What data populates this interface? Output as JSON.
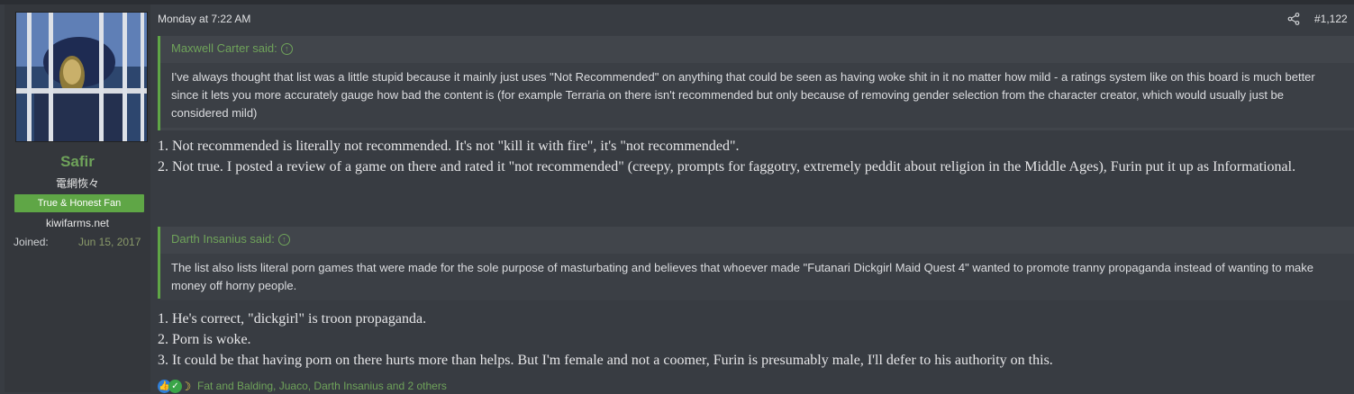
{
  "user": {
    "name": "Safir",
    "title": "電網恢々",
    "banner": "True & Honest Fan",
    "site": "kiwifarms.net",
    "joined_label": "Joined:",
    "joined_value": "Jun 15, 2017"
  },
  "post": {
    "date": "Monday at 7:22 AM",
    "number": "#1,122",
    "quote1": {
      "author": "Maxwell Carter said:",
      "text": "I've always thought that list was a little stupid because it mainly just uses \"Not Recommended\" on anything that could be seen as having woke shit in it no matter how mild - a ratings system like on this board is much better since it lets you more accurately gauge how bad the content is (for example Terraria on there isn't recommended but only because of removing gender selection from the character creator, which would usually just be considered mild)"
    },
    "reply1": [
      "1. Not recommended is literally not recommended. It's not \"kill it with fire\", it's \"not recommended\".",
      "2. Not true. I posted a review of a game on there and rated it \"not recommended\" (creepy, prompts for faggotry, extremely peddit about religion in the Middle Ages), Furin put it up as Informational."
    ],
    "quote2": {
      "author": "Darth Insanius said:",
      "text": "The list also lists literal porn games that were made for the sole purpose of masturbating and believes that whoever made \"Futanari Dickgirl Maid Quest 4\" wanted to promote tranny propaganda instead of wanting to make money off horny people."
    },
    "reply2": [
      "1. He's correct, \"dickgirl\" is troon propaganda.",
      "2. Porn is woke.",
      "3. It could be that having porn on there hurts more than helps. But I'm female and not a coomer, Furin is presumably male, I'll defer to his authority on this."
    ],
    "reactions_text": "Fat and Balding, Juaco, Darth Insanius and 2 others"
  },
  "icons": {
    "share": "share-icon",
    "quote_up": "arrow-up-circle-icon",
    "reactions": [
      "like-icon",
      "check-icon",
      "moon-icon"
    ]
  },
  "colors": {
    "background": "#383c42",
    "accent": "#5fa646",
    "username": "#6fa35a"
  }
}
